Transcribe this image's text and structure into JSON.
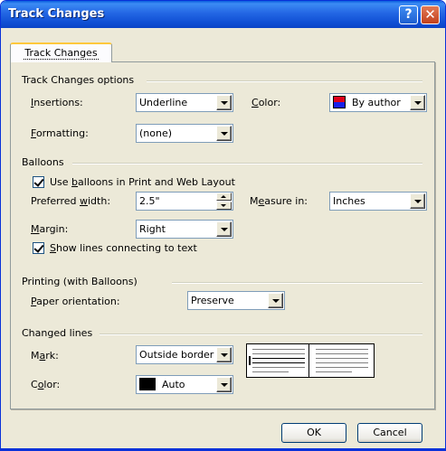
{
  "window": {
    "title": "Track Changes"
  },
  "titlebar_buttons": {
    "help": "?",
    "close": "✕"
  },
  "tab": {
    "label": "Track Changes"
  },
  "track_options": {
    "section": "Track Changes options",
    "insertions_label": "Insertions:",
    "insertions_value": "Underline",
    "color_label": "Color:",
    "color_value": "By author",
    "formatting_label": "Formatting:",
    "formatting_value": "(none)"
  },
  "balloons": {
    "section": "Balloons",
    "use_balloons_label": "Use balloons in Print and Web Layout",
    "use_balloons_checked": true,
    "preferred_width_label": "Preferred width:",
    "preferred_width_value": "2.5\"",
    "measure_in_label": "Measure in:",
    "measure_in_value": "Inches",
    "margin_label": "Margin:",
    "margin_value": "Right",
    "show_lines_label": "Show lines connecting to text",
    "show_lines_checked": true
  },
  "printing": {
    "section": "Printing (with Balloons)",
    "paper_orientation_label": "Paper orientation:",
    "paper_orientation_value": "Preserve"
  },
  "changed_lines": {
    "section": "Changed lines",
    "mark_label": "Mark:",
    "mark_value": "Outside border",
    "color_label": "Color:",
    "color_value": "Auto"
  },
  "buttons": {
    "ok": "OK",
    "cancel": "Cancel"
  },
  "colors": {
    "title_bar": "#0A5FDE",
    "dialog_bg": "#ECE9D8",
    "swatch_red": "#E0001A",
    "swatch_blue": "#1820E8",
    "swatch_auto": "#000000"
  }
}
